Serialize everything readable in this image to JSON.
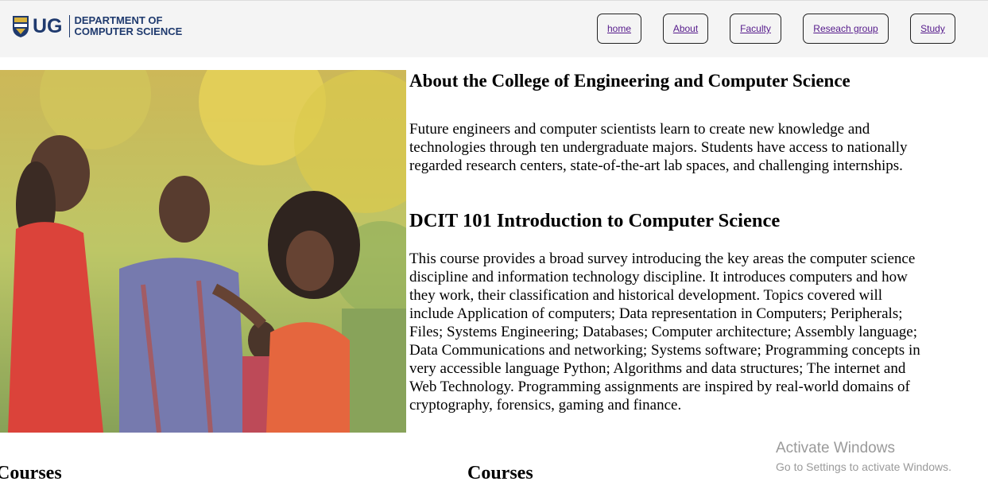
{
  "header": {
    "logo_mark": "UG",
    "logo_text_line1": "DEPARTMENT OF",
    "logo_text_line2": "COMPUTER SCIENCE"
  },
  "nav": {
    "items": [
      {
        "label": "home"
      },
      {
        "label": "About"
      },
      {
        "label": "Faculty"
      },
      {
        "label": "Reseach group"
      },
      {
        "label": "Study"
      }
    ]
  },
  "about": {
    "title": "About the College of Engineering and Computer Science",
    "text": "Future engineers and computer scientists learn to create new knowledge and technologies through ten undergraduate majors. Students have access to nationally regarded research centers, state-of-the-art lab spaces, and challenging internships."
  },
  "course": {
    "title": "DCIT 101 Introduction to Computer Science",
    "text": "This course provides a broad survey introducing the key areas the computer science discipline and information technology discipline. It introduces computers and how they work, their classification and historical development. Topics covered will include Application of computers; Data representation in Computers; Peripherals; Files; Systems Engineering; Databases; Computer architecture; Assembly language; Data Communications and networking; Systems software; Programming concepts in very accessible language Python; Algorithms and data structures; The internet and Web Technology. Programming assignments are inspired by real-world domains of cryptography, forensics, gaming and finance."
  },
  "sections": {
    "courses_left": "Courses",
    "courses_right": "Courses"
  },
  "watermark": {
    "title": "Activate Windows",
    "subtitle": "Go to Settings to activate Windows."
  },
  "colors": {
    "brand": "#1f3a6e",
    "link": "#551a8b",
    "topbar_bg": "#f4f4f4"
  }
}
